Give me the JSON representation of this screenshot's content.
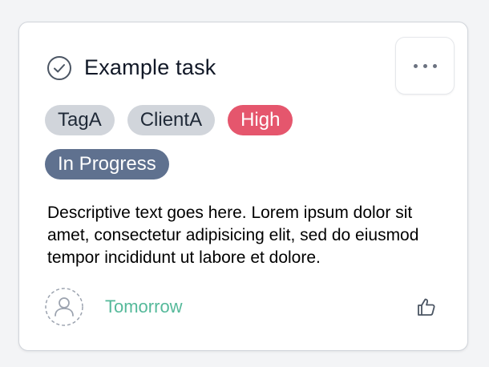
{
  "task": {
    "title": "Example task",
    "tags": [
      "TagA",
      "ClientA"
    ],
    "priority": "High",
    "status": "In Progress",
    "description": "Descriptive text goes here. Lorem ipsum dolor sit amet, consectetur adipisicing elit, sed do eiusmod tempor incididunt ut labore et dolore.",
    "due": "Tomorrow"
  },
  "icons": {
    "complete": "check-circle-icon",
    "menu": "more-horizontal-icon",
    "assignee": "user-placeholder-icon",
    "like": "thumbs-up-icon"
  },
  "colors": {
    "priority_high": "#e5566d",
    "status": "#5f718f",
    "tag": "#d1d5db",
    "due": "#55b99a"
  }
}
